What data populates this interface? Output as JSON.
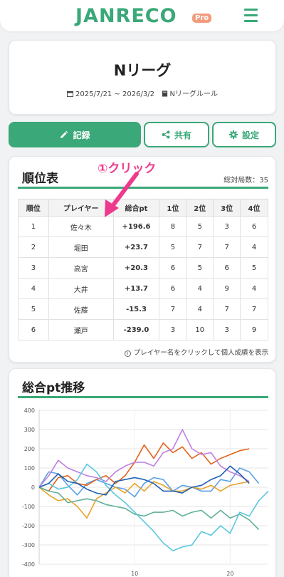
{
  "app": {
    "logo": "JANRECO",
    "badge": "Pro"
  },
  "league": {
    "title": "Nリーグ",
    "period": "2025/7/21 ~ 2026/3/2",
    "rule": "Nリーグルール"
  },
  "actions": {
    "record": "記録",
    "share": "共有",
    "settings": "設定"
  },
  "ranking": {
    "title": "順位表",
    "total_games": "総対局数：35",
    "annotation": "①クリック",
    "headers": [
      "順位",
      "プレイヤー",
      "総合pt",
      "1位",
      "2位",
      "3位",
      "4位"
    ],
    "rows": [
      {
        "rank": "1",
        "player": "佐々木",
        "pt": "+196.6",
        "first": "8",
        "second": "5",
        "third": "3",
        "fourth": "6"
      },
      {
        "rank": "2",
        "player": "堀田",
        "pt": "+23.7",
        "first": "5",
        "second": "7",
        "third": "7",
        "fourth": "4"
      },
      {
        "rank": "3",
        "player": "高宮",
        "pt": "+20.3",
        "first": "6",
        "second": "5",
        "third": "6",
        "fourth": "5"
      },
      {
        "rank": "4",
        "player": "大井",
        "pt": "+13.7",
        "first": "6",
        "second": "4",
        "third": "9",
        "fourth": "4"
      },
      {
        "rank": "5",
        "player": "佐藤",
        "pt": "-15.3",
        "first": "7",
        "second": "4",
        "third": "7",
        "fourth": "7"
      },
      {
        "rank": "6",
        "player": "瀬戸",
        "pt": "-239.0",
        "first": "3",
        "second": "10",
        "third": "3",
        "fourth": "9"
      }
    ],
    "hint": "プレイヤー名をクリックして個人成績を表示"
  },
  "trend": {
    "title": "総合pt推移"
  },
  "colors": {
    "brand": "#3aa878",
    "positive": "#2e9a6a",
    "negative": "#b23b3b",
    "annotation": "#ee3a8c"
  },
  "chart_data": {
    "type": "line",
    "title": "総合pt推移",
    "ylim": [
      -400,
      400
    ],
    "xlim": [
      0,
      24
    ],
    "yticks": [
      "400",
      "300",
      "200",
      "100",
      "0",
      "-100",
      "-200",
      "-300",
      "-400"
    ],
    "xticks": [
      "10",
      "20"
    ],
    "grid": true,
    "series": [
      {
        "color": "#5aa0e6",
        "values": [
          0,
          80,
          70,
          10,
          -40,
          20,
          40,
          20,
          0,
          -10,
          -50,
          20,
          50,
          40,
          -20,
          10,
          0,
          -20,
          -20,
          40,
          30,
          100,
          80,
          20
        ]
      },
      {
        "color": "#e3621c",
        "values": [
          0,
          -20,
          50,
          60,
          20,
          10,
          40,
          60,
          20,
          60,
          130,
          220,
          150,
          230,
          180,
          210,
          150,
          180,
          120,
          150,
          170,
          190,
          200
        ]
      },
      {
        "color": "#c37fe0",
        "values": [
          0,
          60,
          140,
          100,
          80,
          60,
          50,
          30,
          80,
          110,
          130,
          130,
          110,
          180,
          200,
          300,
          200,
          170,
          180,
          110,
          80,
          60,
          30
        ]
      },
      {
        "color": "#e8a22a",
        "values": [
          0,
          -40,
          -70,
          -60,
          -100,
          -160,
          -60,
          -30,
          0,
          -30,
          20,
          -20,
          30,
          10,
          -20,
          -20,
          0,
          -10,
          10,
          -20,
          10,
          20,
          30
        ]
      },
      {
        "color": "#5fb09a",
        "values": [
          0,
          -20,
          -30,
          -80,
          -70,
          -60,
          -70,
          -90,
          -100,
          -110,
          -140,
          -150,
          -130,
          -130,
          -120,
          -150,
          -130,
          -120,
          -160,
          -120,
          -160,
          -140,
          -170,
          -220
        ]
      },
      {
        "color": "#5bc8e0",
        "values": [
          0,
          20,
          -10,
          0,
          40,
          120,
          80,
          10,
          -40,
          -80,
          -130,
          -180,
          -230,
          -290,
          -330,
          -310,
          -300,
          -230,
          -250,
          -200,
          -240,
          -130,
          -150,
          -70,
          -20
        ]
      },
      {
        "color": "#1f5fb0",
        "values": [
          0,
          20,
          70,
          30,
          20,
          -10,
          -30,
          -40,
          30,
          40,
          50,
          40,
          20,
          -20,
          -20,
          -30,
          0,
          10,
          40,
          60,
          110,
          70,
          20
        ]
      }
    ]
  }
}
